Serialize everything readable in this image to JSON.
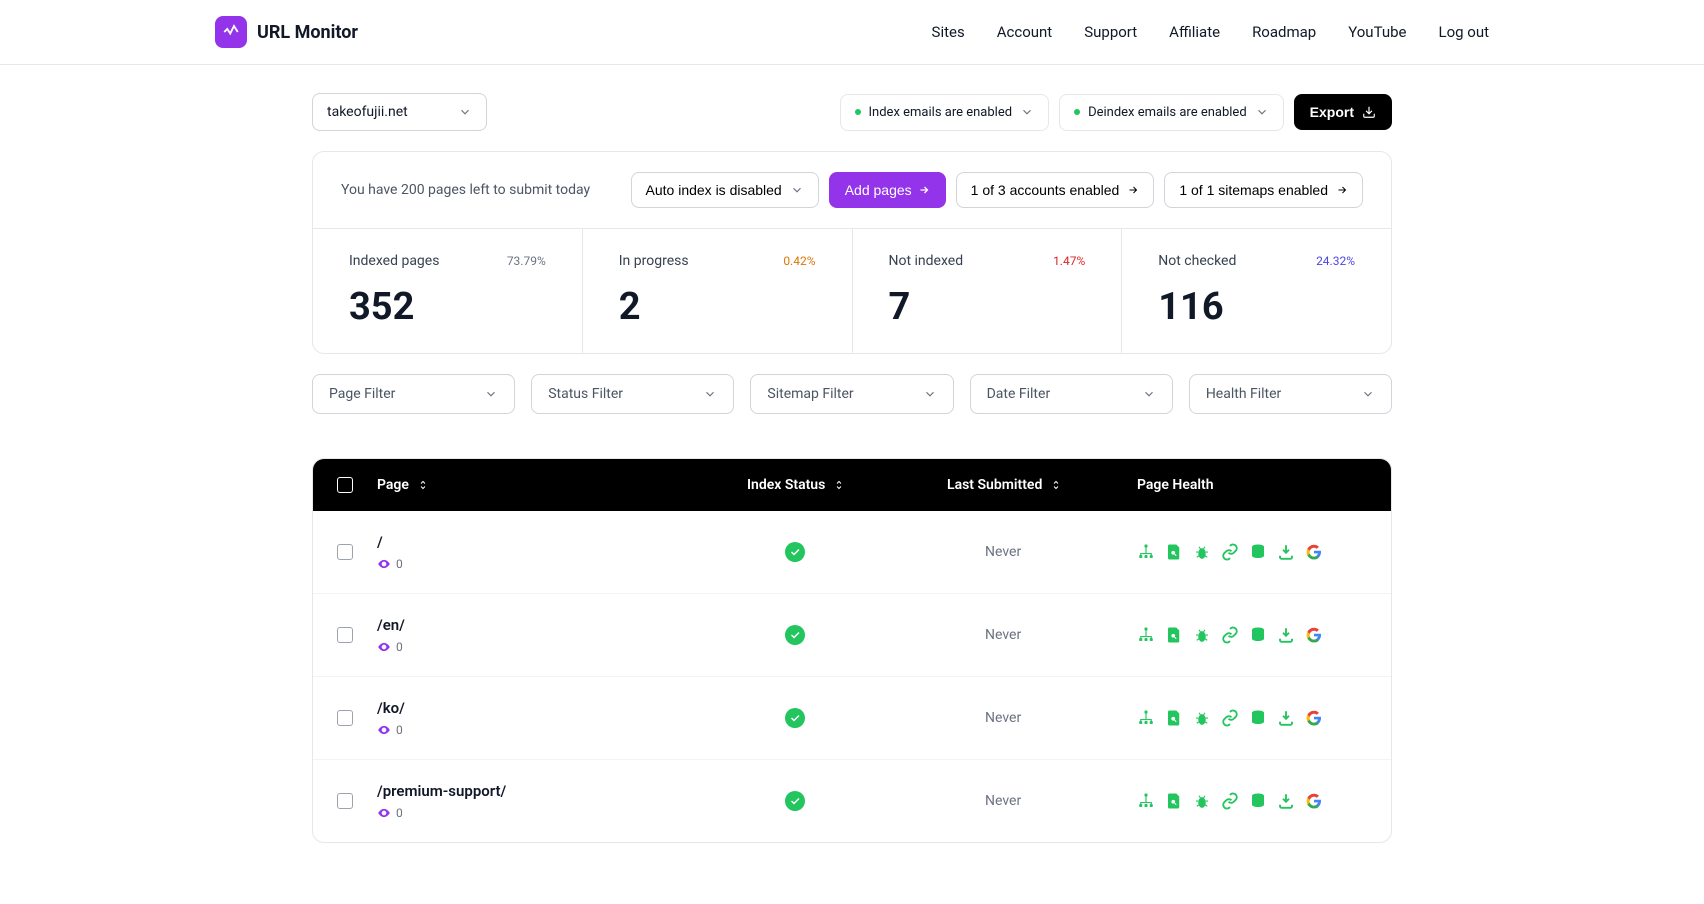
{
  "brand": "URL Monitor",
  "nav": {
    "sites": "Sites",
    "account": "Account",
    "support": "Support",
    "affiliate": "Affiliate",
    "roadmap": "Roadmap",
    "youtube": "YouTube",
    "logout": "Log out"
  },
  "siteSelect": "takeofujii.net",
  "indexEmails": "Index emails are enabled",
  "deindexEmails": "Deindex emails are enabled",
  "exportLabel": "Export",
  "submitMsg": "You have 200 pages left to submit today",
  "actions": {
    "autoIndex": "Auto index is disabled",
    "addPages": "Add pages",
    "accounts": "1 of 3 accounts enabled",
    "sitemaps": "1 of 1 sitemaps enabled"
  },
  "stats": {
    "indexed": {
      "label": "Indexed pages",
      "pct": "73.79%",
      "num": "352",
      "color": "#6b7280"
    },
    "progress": {
      "label": "In progress",
      "pct": "0.42%",
      "num": "2",
      "color": "#d97706"
    },
    "notIndexed": {
      "label": "Not indexed",
      "pct": "1.47%",
      "num": "7",
      "color": "#dc2626"
    },
    "notChecked": {
      "label": "Not checked",
      "pct": "24.32%",
      "num": "116",
      "color": "#4f46e5"
    }
  },
  "filters": {
    "page": "Page Filter",
    "status": "Status Filter",
    "sitemap": "Sitemap Filter",
    "date": "Date Filter",
    "health": "Health Filter"
  },
  "columns": {
    "page": "Page",
    "status": "Index Status",
    "submitted": "Last Submitted",
    "health": "Page Health"
  },
  "rows": [
    {
      "path": "/",
      "views": "0",
      "submitted": "Never"
    },
    {
      "path": "/en/",
      "views": "0",
      "submitted": "Never"
    },
    {
      "path": "/ko/",
      "views": "0",
      "submitted": "Never"
    },
    {
      "path": "/premium-support/",
      "views": "0",
      "submitted": "Never"
    }
  ]
}
